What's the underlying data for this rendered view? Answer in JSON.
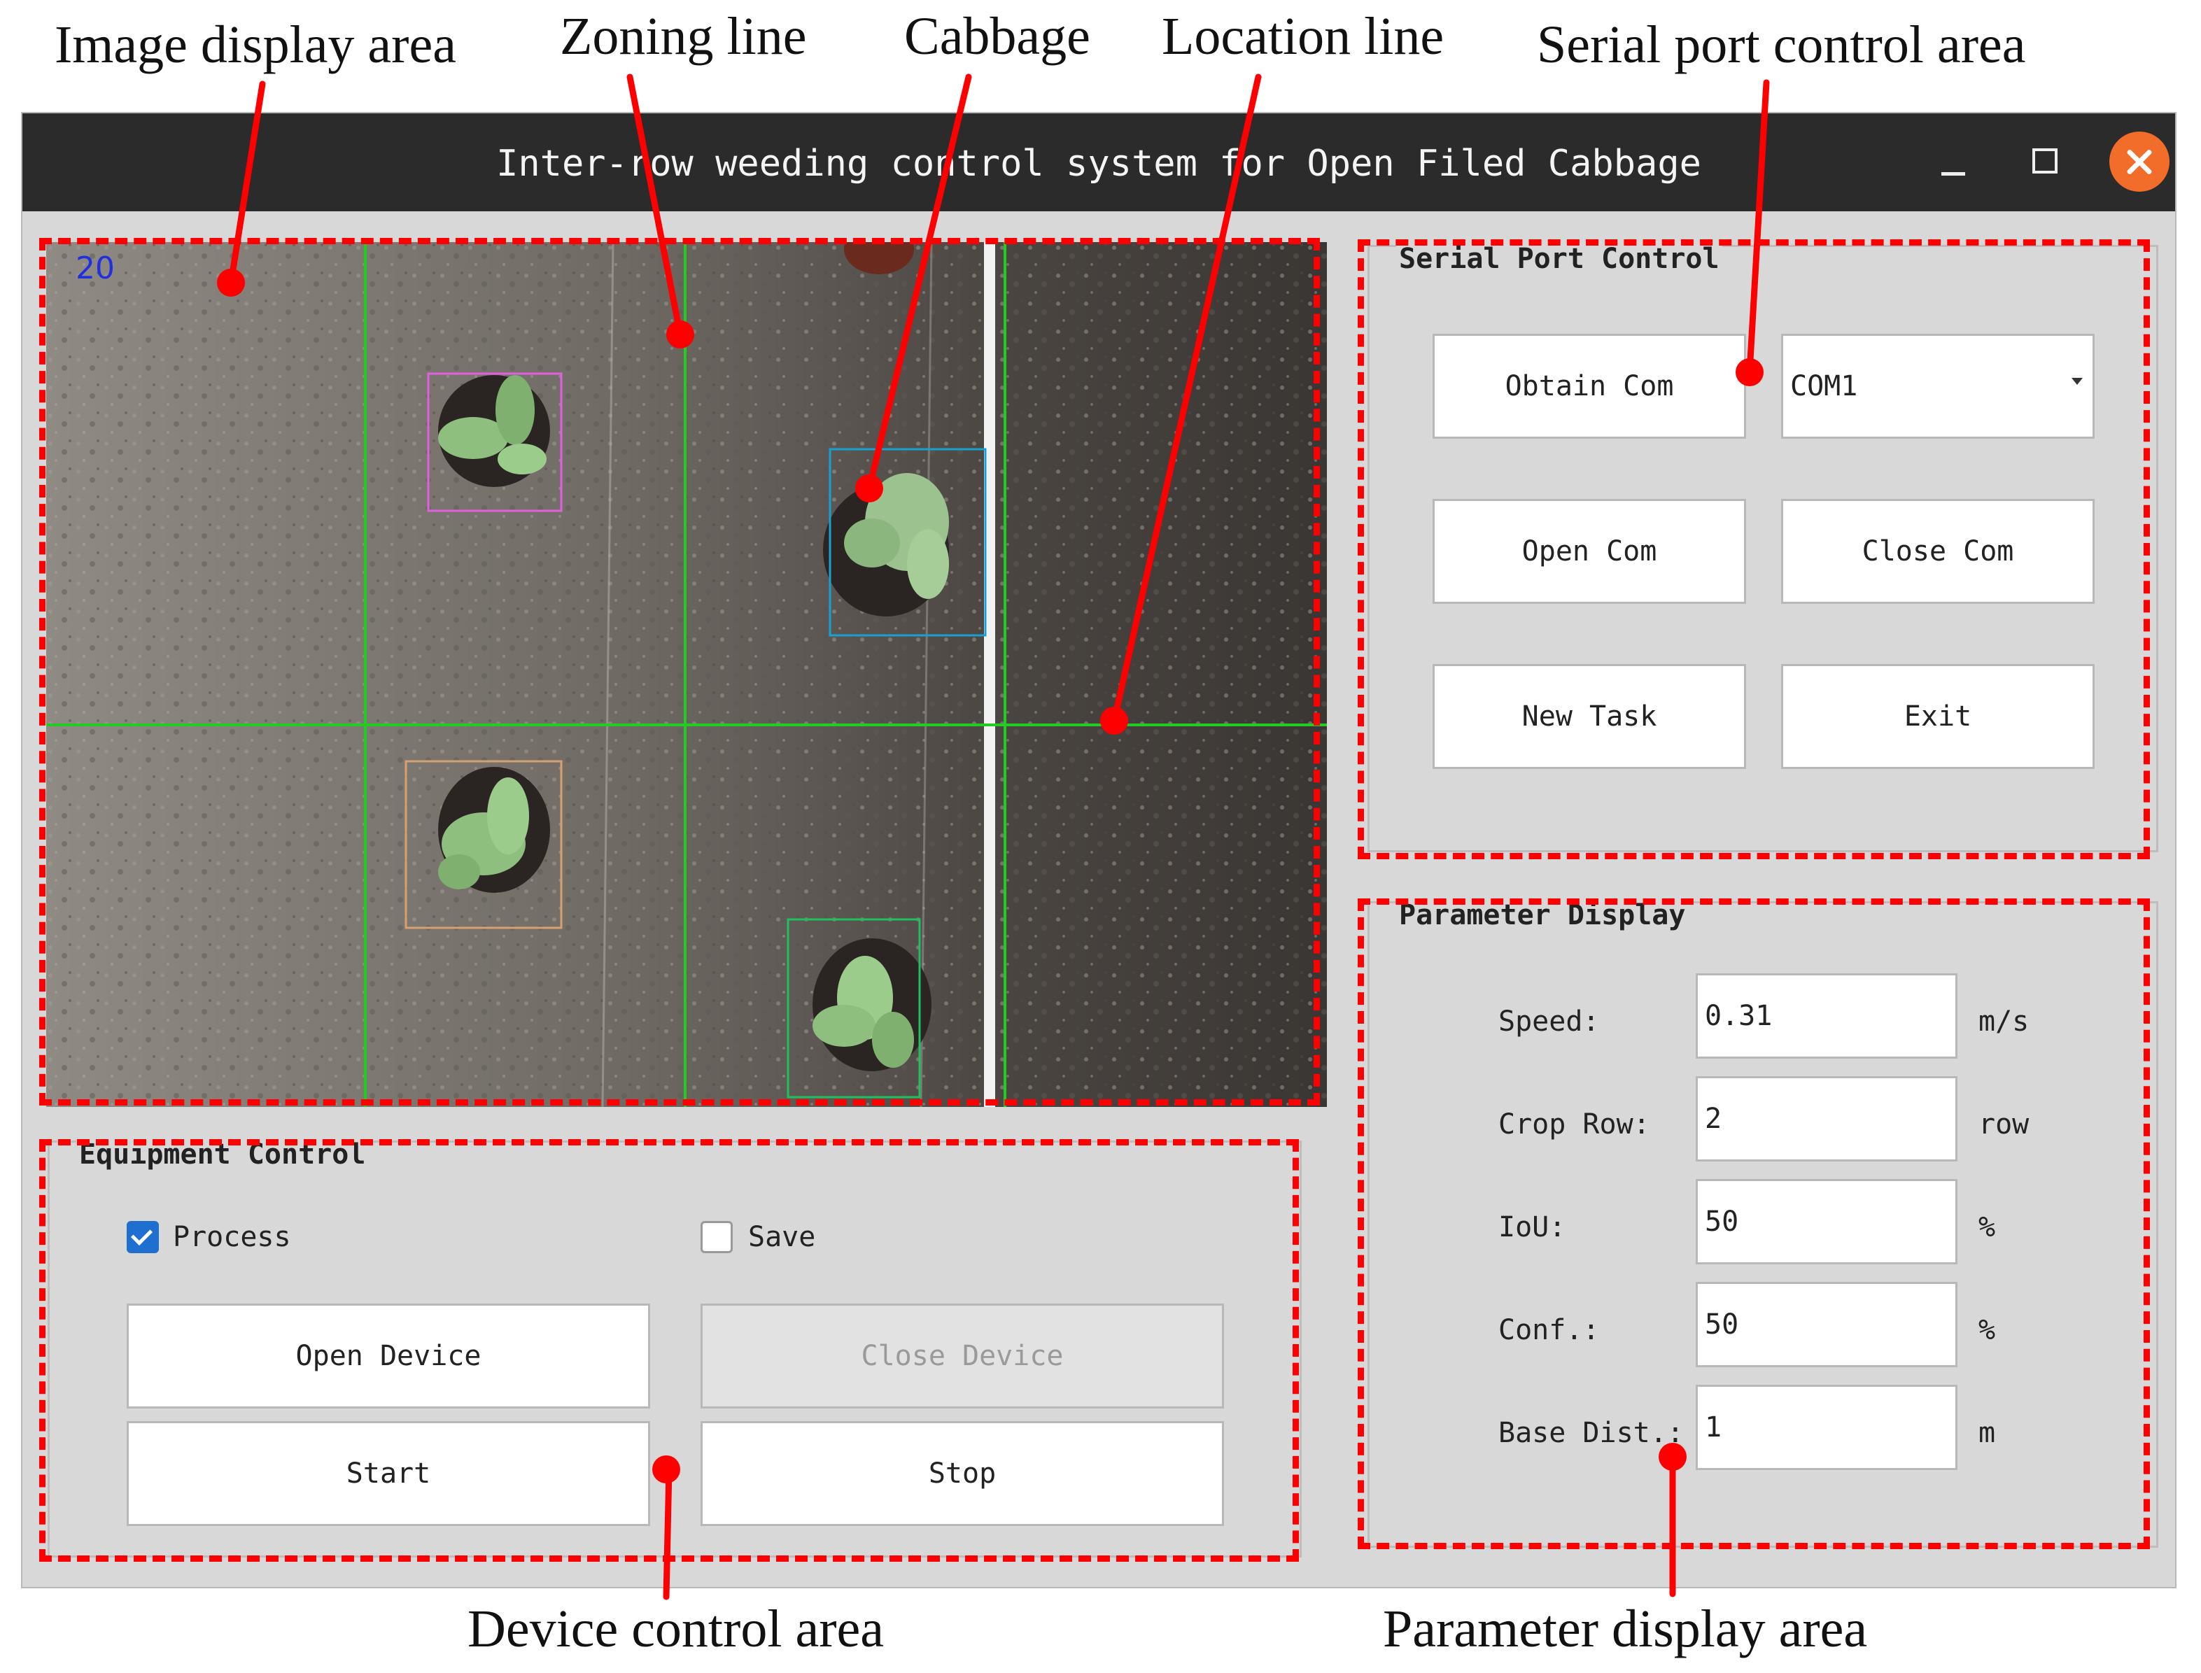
{
  "callouts": {
    "image_display_area": "Image display area",
    "zoning_line": "Zoning line",
    "cabbage": "Cabbage",
    "location_line": "Location line",
    "serial_port_control_area": "Serial port control area",
    "device_control_area": "Device control area",
    "parameter_display_area": "Parameter display area"
  },
  "window": {
    "title": "Inter-row weeding control system for Open Filed Cabbage"
  },
  "image_view": {
    "frame_counter": "20"
  },
  "serial_port": {
    "group_title": "Serial Port Control",
    "obtain_com": "Obtain Com",
    "com_select_value": "COM1",
    "open_com": "Open Com",
    "close_com": "Close Com",
    "new_task": "New Task",
    "exit": "Exit"
  },
  "parameters": {
    "group_title": "Parameter Display",
    "rows": [
      {
        "label": "Speed:",
        "value": "0.31",
        "unit": "m/s"
      },
      {
        "label": "Crop Row:",
        "value": "2",
        "unit": "row"
      },
      {
        "label": "IoU:",
        "value": "50",
        "unit": "%"
      },
      {
        "label": "Conf.:",
        "value": "50",
        "unit": "%"
      },
      {
        "label": "Base Dist.:",
        "value": "1",
        "unit": "m"
      }
    ]
  },
  "equipment": {
    "group_title": "Equipment Control",
    "process_label": "Process",
    "process_checked": true,
    "save_label": "Save",
    "save_checked": false,
    "open_device": "Open Device",
    "close_device": "Close Device",
    "start": "Start",
    "stop": "Stop"
  },
  "colors": {
    "annotation_red": "#ff0000",
    "zoning_line_green": "#22cc22",
    "titlebar": "#2b2b2b",
    "close_button": "#f26c2a",
    "checkbox_blue": "#1f6fd1"
  }
}
